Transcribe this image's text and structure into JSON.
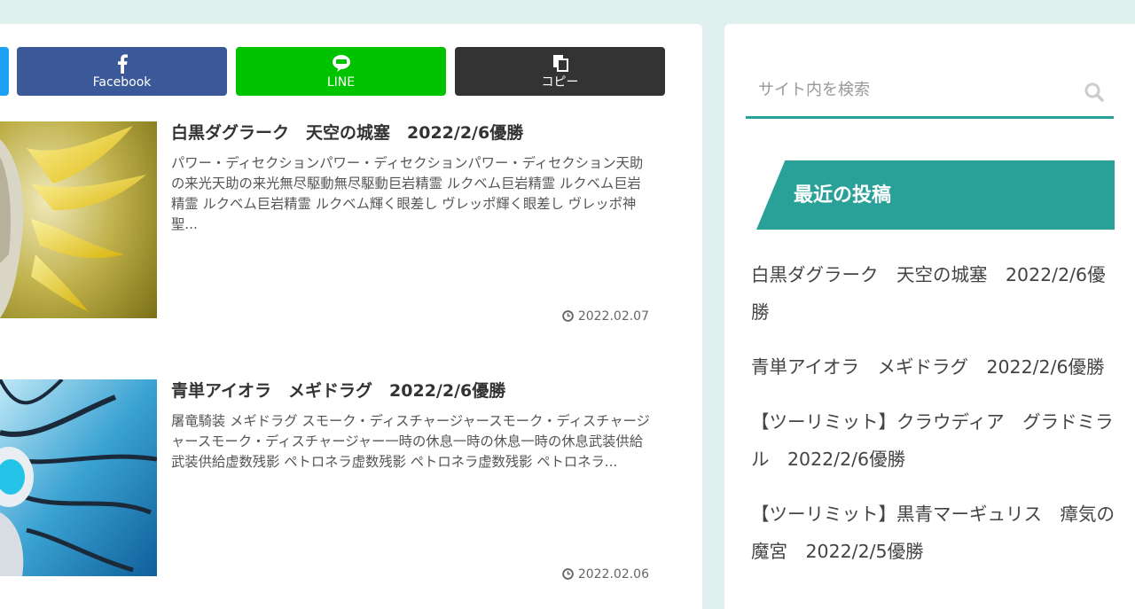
{
  "share": {
    "facebook_label": "Facebook",
    "line_label": "LINE",
    "copy_label": "コピー"
  },
  "posts": [
    {
      "title": "白黒ダグラーク　天空の城塞　2022/2/6優勝",
      "excerpt": "パワー・ディセクションパワー・ディセクションパワー・ディセクション天助の来光天助の来光無尽駆動無尽駆動巨岩精霊 ルクベム巨岩精霊 ルクベム巨岩精霊 ルクベム巨岩精霊 ルクベム輝く眼差し ヴレッポ輝く眼差し ヴレッポ神聖...",
      "date": "2022.02.07"
    },
    {
      "title": "青単アイオラ　メギドラグ　2022/2/6優勝",
      "excerpt": "屠竜騎装 メギドラグ スモーク・ディスチャージャースモーク・ディスチャージャースモーク・ディスチャージャー一時の休息一時の休息一時の休息武装供給武装供給虚数残影 ペトロネラ虚数残影 ペトロネラ虚数残影 ペトロネラ...",
      "date": "2022.02.06"
    }
  ],
  "sidebar": {
    "search_placeholder": "サイト内を検索",
    "recent_title": "最近の投稿",
    "recent_posts": [
      "白黒ダグラーク　天空の城塞　2022/2/6優勝",
      "青単アイオラ　メギドラグ　2022/2/6優勝",
      "【ツーリミット】クラウディア　グラドミラル　2022/2/6優勝",
      "【ツーリミット】黒青マーギュリス　瘴気の魔宮　2022/2/5優勝"
    ]
  },
  "colors": {
    "accent": "#2aa198",
    "facebook": "#3b5998",
    "line": "#00c300",
    "copy": "#333333",
    "page_bg": "#dff0ef"
  }
}
